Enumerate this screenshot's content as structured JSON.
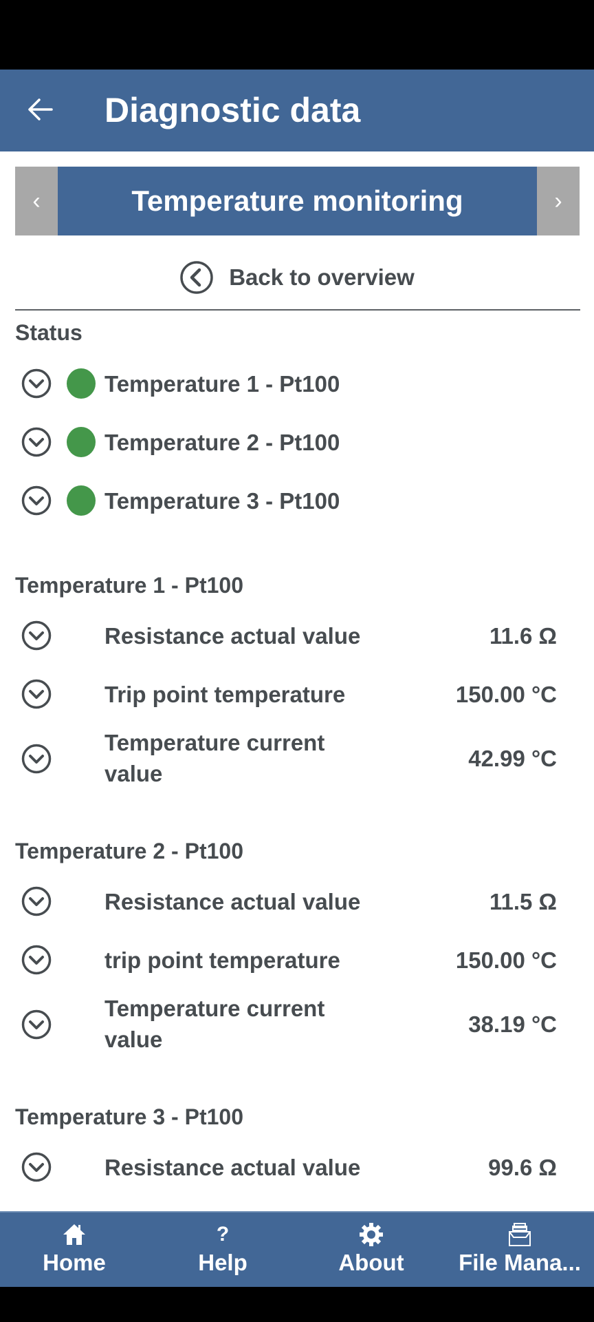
{
  "appbar": {
    "title": "Diagnostic data"
  },
  "pager": {
    "title": "Temperature monitoring",
    "prev": "‹",
    "next": "›"
  },
  "back_link": {
    "label": "Back to overview"
  },
  "status": {
    "title": "Status",
    "items": [
      {
        "label": "Temperature 1 - Pt100",
        "state": "ok",
        "color": "#44974a"
      },
      {
        "label": "Temperature 2 - Pt100",
        "state": "ok",
        "color": "#44974a"
      },
      {
        "label": "Temperature 3 - Pt100",
        "state": "ok",
        "color": "#44974a"
      }
    ]
  },
  "sections": [
    {
      "title": "Temperature 1 - Pt100",
      "rows": [
        {
          "label": "Resistance actual value",
          "value": "11.6 Ω"
        },
        {
          "label": "Trip point temperature",
          "value": "150.00 °C"
        },
        {
          "label_line1": "Temperature current",
          "label_line2": "value",
          "value": "42.99 °C"
        }
      ]
    },
    {
      "title": "Temperature 2 - Pt100",
      "rows": [
        {
          "label": "Resistance actual value",
          "value": "11.5 Ω"
        },
        {
          "label": "trip point temperature",
          "value": "150.00 °C"
        },
        {
          "label_line1": "Temperature current",
          "label_line2": "value",
          "value": "38.19 °C"
        }
      ]
    },
    {
      "title": "Temperature 3 - Pt100",
      "rows": [
        {
          "label": "Resistance actual value",
          "value": "99.6 Ω"
        }
      ]
    }
  ],
  "bottom_nav": [
    {
      "label": "Home",
      "icon": "home-icon"
    },
    {
      "label": "Help",
      "icon": "help-icon"
    },
    {
      "label": "About",
      "icon": "gear-icon"
    },
    {
      "label": "File Mana...",
      "icon": "file-tray-icon"
    }
  ],
  "colors": {
    "brand": "#426796",
    "pager_side": "#a8a8a8",
    "status_ok": "#44974a",
    "text": "#474c50"
  }
}
